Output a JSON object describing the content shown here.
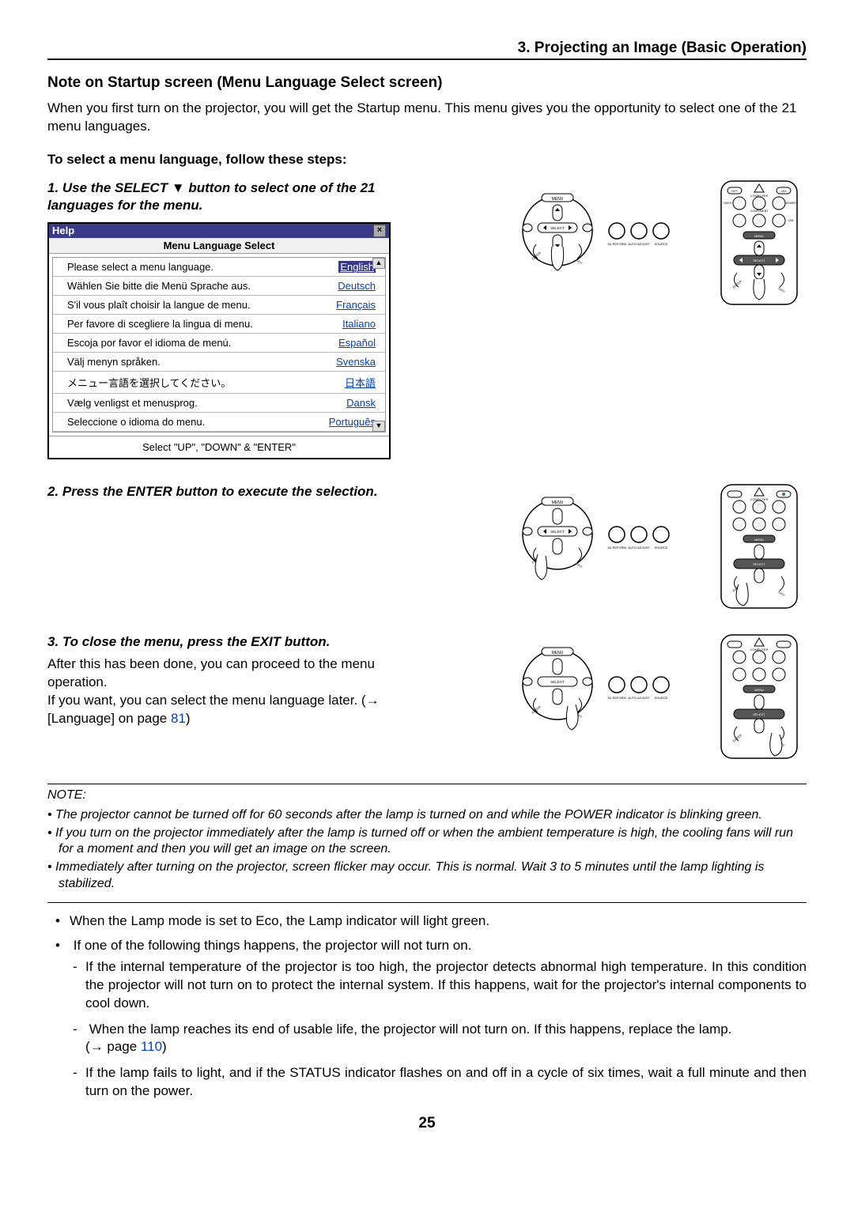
{
  "section_header": "3. Projecting an Image (Basic Operation)",
  "note_title": "Note on Startup screen (Menu Language Select screen)",
  "intro": "When you first turn on the projector, you will get the Startup menu. This menu gives you the opportunity to select one of the 21 menu languages.",
  "steps_title": "To select a menu language, follow these steps:",
  "step1_head": "1.  Use the SELECT ▼ button to select one of the 21 languages for the menu.",
  "menu": {
    "help": "Help",
    "title": "Menu Language Select",
    "items": [
      {
        "prompt": "Please select a menu language.",
        "lang": "English"
      },
      {
        "prompt": "Wählen Sie bitte die Menü Sprache aus.",
        "lang": "Deutsch"
      },
      {
        "prompt": "S'il vous plaît choisir la langue de menu.",
        "lang": "Français"
      },
      {
        "prompt": "Per favore di scegliere la lingua di menu.",
        "lang": "Italiano"
      },
      {
        "prompt": "Escoja por favor el idioma de menú.",
        "lang": "Español"
      },
      {
        "prompt": "Välj menyn språken.",
        "lang": "Svenska"
      },
      {
        "prompt": "メニュー言語を選択してください。",
        "lang": "日本語"
      },
      {
        "prompt": "Vælg venligst et menusprog.",
        "lang": "Dansk"
      },
      {
        "prompt": "Seleccione o idioma do menu.",
        "lang": "Português"
      }
    ],
    "footer": "Select   \"UP\", \"DOWN\"   &   \"ENTER\""
  },
  "step2_head": "2.  Press the ENTER button to execute the selection.",
  "step3_head": "3.  To close the menu, press the EXIT button.",
  "step3_body_a": "After this has been done, you can proceed to the menu operation.",
  "step3_body_b": "If you want, you can select the menu language later. (→ [Language] on page ",
  "step3_page": "81",
  "step3_body_c": ")",
  "note_block": {
    "label": "NOTE:",
    "items": [
      "The projector cannot be turned off for 60 seconds after the lamp is turned on and while the POWER indicator is blinking green.",
      "If you turn on the projector immediately after the lamp is turned off or when the ambient temperature is high, the cooling fans will run for a moment and then you will get an image on the screen.",
      "Immediately after turning on the projector, screen flicker may occur. This is normal. Wait 3 to 5 minutes until the lamp lighting is stabilized."
    ]
  },
  "bullets": {
    "items": [
      "When the Lamp mode is set to Eco, the Lamp indicator will light green.",
      "If one of the following things happens, the projector will not turn on."
    ],
    "sub": [
      "If the internal temperature of the projector is too high, the projector detects abnormal high temperature. In this condition the projector will not turn on to protect the internal system. If this happens, wait for the projector's internal components to cool down.",
      "When the lamp reaches its end of usable life, the projector will not turn on. If this happens, replace the lamp.",
      "If the lamp fails to light, and if the STATUS indicator flashes on and off in a cycle of six times, wait a full minute and then turn on the power."
    ],
    "sub_page_prefix": "(→ page ",
    "sub_page": "110",
    "sub_page_suffix": ")"
  },
  "page_number": "25",
  "diagram_labels": {
    "menu": "MENU",
    "select": "SELECT",
    "enter": "ENTER",
    "exit": "EXIT",
    "reform": "3D REFORM",
    "auto": "AUTO ADJUST",
    "source": "SOURCE",
    "off": "OFF",
    "on": "ON",
    "computer": "COMPUTER",
    "video": "VIDEO",
    "component": "COMPONENT",
    "viewer": "VIEWER",
    "lan": "LAN"
  }
}
